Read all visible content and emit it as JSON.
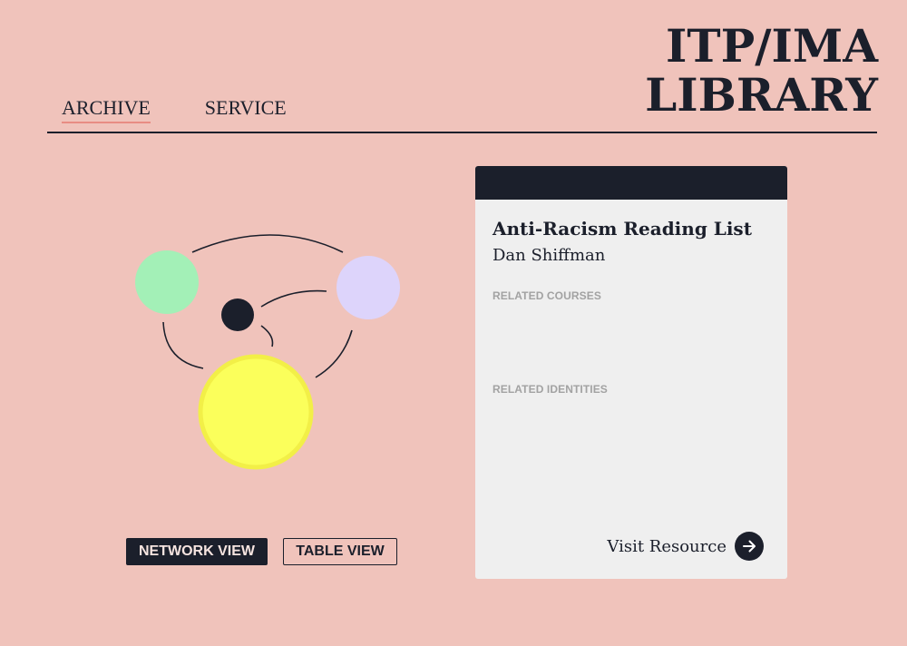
{
  "header": {
    "title_line1": "ITP/IMA",
    "title_line2": "LIBRARY"
  },
  "nav": {
    "items": [
      {
        "label": "ARCHIVE",
        "active": true
      },
      {
        "label": "SERVICE",
        "active": false
      }
    ]
  },
  "network": {
    "nodes": [
      {
        "name": "green",
        "color": "#a3f0b7"
      },
      {
        "name": "purple",
        "color": "#ddd4fb"
      },
      {
        "name": "dark",
        "color": "#1b1f2b"
      },
      {
        "name": "yellow",
        "color": "#fbff5b",
        "stroke": "#f2ef47"
      }
    ]
  },
  "views": {
    "network_label": "NETWORK VIEW",
    "table_label": "TABLE VIEW",
    "selected": "network"
  },
  "card": {
    "title": "Anti-Racism Reading List",
    "author": "Dan Shiffman",
    "related_courses_label": "RELATED COURSES",
    "related_identities_label": "RELATED IDENTITIES",
    "visit_label": "Visit Resource",
    "visit_icon": "arrow-right-icon"
  },
  "colors": {
    "background": "#f0c3bb",
    "ink": "#1b1f2b",
    "card": "#efefef",
    "accent_underline": "#e88c83"
  }
}
